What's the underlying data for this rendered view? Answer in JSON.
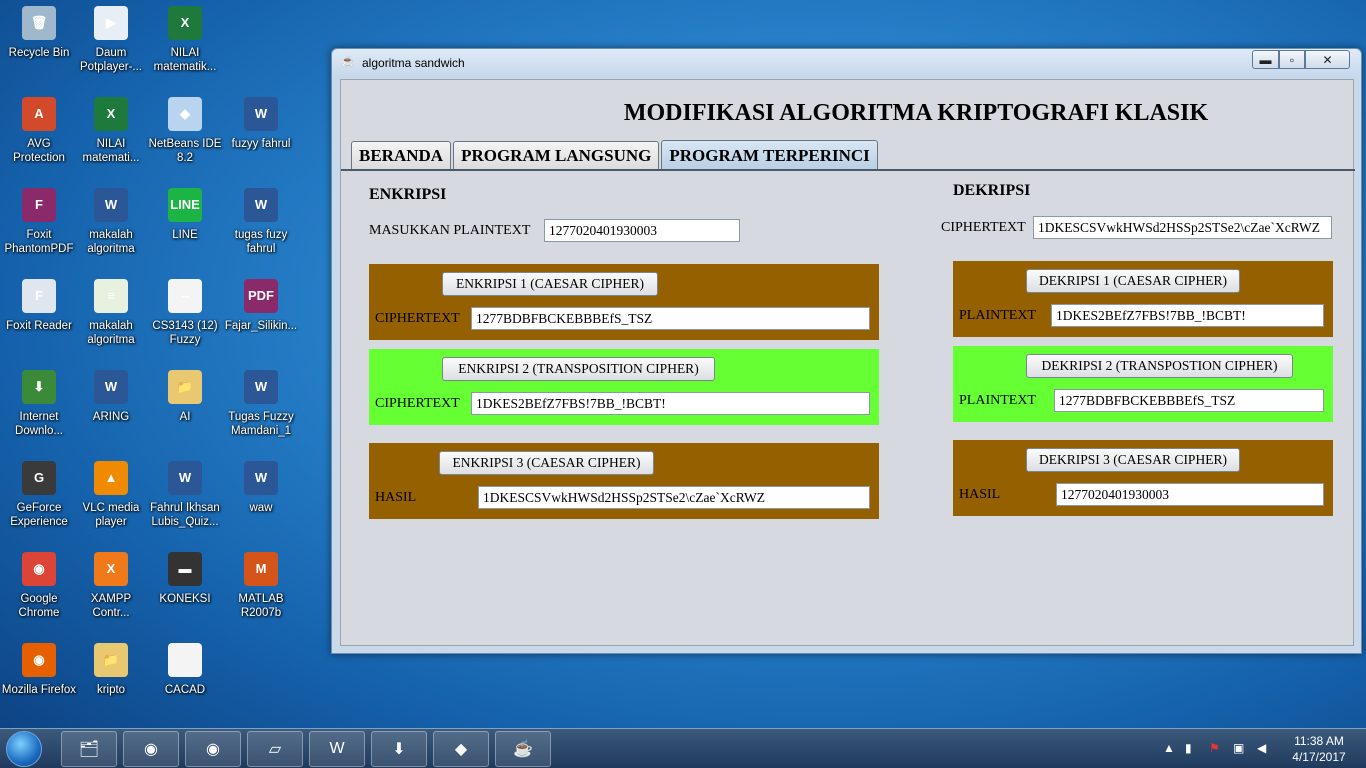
{
  "desktop": {
    "icons": [
      {
        "label": "Recycle Bin",
        "icon": "recycle-bin-icon",
        "color": "#9fb8cc",
        "glyph": "🗑"
      },
      {
        "label": "Daum Potplayer-...",
        "icon": "potplayer-icon",
        "color": "#e8eef5",
        "glyph": "▶"
      },
      {
        "label": "NILAI matematik...",
        "icon": "excel-file-icon",
        "color": "#1e7a3c",
        "glyph": "X"
      },
      {
        "label": "AVG Protection",
        "icon": "avg-icon",
        "color": "#d24a2a",
        "glyph": "A"
      },
      {
        "label": "NILAI matemati...",
        "icon": "excel-file-icon",
        "color": "#1e7a3c",
        "glyph": "X"
      },
      {
        "label": "NetBeans IDE 8.2",
        "icon": "netbeans-icon",
        "color": "#b8d4ee",
        "glyph": "◆"
      },
      {
        "label": "fuzyy fahrul",
        "icon": "word-file-icon",
        "color": "#2b5797",
        "glyph": "W"
      },
      {
        "label": "Foxit PhantomPDF",
        "icon": "foxit-phantom-icon",
        "color": "#8a2a6a",
        "glyph": "F"
      },
      {
        "label": "makalah algoritma",
        "icon": "word-file-icon",
        "color": "#2b5797",
        "glyph": "W"
      },
      {
        "label": "LINE",
        "icon": "line-app-icon",
        "color": "#1db446",
        "glyph": "LINE"
      },
      {
        "label": "tugas fuzy fahrul",
        "icon": "word-file-icon",
        "color": "#2b5797",
        "glyph": "W"
      },
      {
        "label": "Foxit Reader",
        "icon": "foxit-reader-icon",
        "color": "#e0e6ee",
        "glyph": "F"
      },
      {
        "label": "makalah algoritma",
        "icon": "document-icon",
        "color": "#e8f0e0",
        "glyph": "≡"
      },
      {
        "label": "CS3143 (12) Fuzzy",
        "icon": "text-file-icon",
        "color": "#f4f4f4",
        "glyph": "--"
      },
      {
        "label": "Fajar_Silikin...",
        "icon": "pdf-file-icon",
        "color": "#8a2a6a",
        "glyph": "PDF"
      },
      {
        "label": "Internet Downlo...",
        "icon": "idm-icon",
        "color": "#3a8a3a",
        "glyph": "⬇"
      },
      {
        "label": "ARING",
        "icon": "word-file-icon",
        "color": "#2b5797",
        "glyph": "W"
      },
      {
        "label": "AI",
        "icon": "folder-icon",
        "color": "#e8c870",
        "glyph": "📁"
      },
      {
        "label": "Tugas Fuzzy Mamdani_1",
        "icon": "word-file-icon",
        "color": "#2b5797",
        "glyph": "W"
      },
      {
        "label": "GeForce Experience",
        "icon": "geforce-icon",
        "color": "#3a3a3a",
        "glyph": "G"
      },
      {
        "label": "VLC media player",
        "icon": "vlc-icon",
        "color": "#f08a00",
        "glyph": "▲"
      },
      {
        "label": "Fahrul Ikhsan Lubis_Quiz...",
        "icon": "word-file-icon",
        "color": "#2b5797",
        "glyph": "W"
      },
      {
        "label": "waw",
        "icon": "word-file-icon",
        "color": "#2b5797",
        "glyph": "W"
      },
      {
        "label": "Google Chrome",
        "icon": "chrome-icon",
        "color": "#db4437",
        "glyph": "◉"
      },
      {
        "label": "XAMPP Contr...",
        "icon": "xampp-icon",
        "color": "#f07a1a",
        "glyph": "X"
      },
      {
        "label": "KONEKSI",
        "icon": "connection-icon",
        "color": "#333",
        "glyph": "▬"
      },
      {
        "label": "MATLAB R2007b",
        "icon": "matlab-icon",
        "color": "#d4541a",
        "glyph": "M"
      },
      {
        "label": "Mozilla Firefox",
        "icon": "firefox-icon",
        "color": "#e66000",
        "glyph": "◉"
      },
      {
        "label": "kripto",
        "icon": "folder-icon",
        "color": "#e8c870",
        "glyph": "📁"
      },
      {
        "label": "CACAD",
        "icon": "blank-file-icon",
        "color": "#f4f4f4",
        "glyph": ""
      }
    ]
  },
  "window": {
    "title": "algoritma sandwich",
    "min_glyph": "▬",
    "max_glyph": "▫",
    "close_glyph": "✕"
  },
  "app": {
    "heading": "MODIFIKASI ALGORITMA KRIPTOGRAFI  KLASIK",
    "tabs": [
      "BERANDA",
      "PROGRAM LANGSUNG",
      "PROGRAM TERPERINCI"
    ],
    "active_tab": 2,
    "enkripsi": {
      "title": "ENKRIPSI",
      "plaintext_label": "MASUKKAN PLAINTEXT",
      "plaintext_value": "1277020401930003",
      "step1": {
        "button": "ENKRIPSI 1 (CAESAR CIPHER)",
        "label": "CIPHERTEXT",
        "value": "1277BDBFBCKEBBBEfS_TSZ"
      },
      "step2": {
        "button": "ENKRIPSI 2 (TRANSPOSITION CIPHER)",
        "label": "CIPHERTEXT",
        "value": "1DKES2BEfZ7FBS!7BB_!BCBT!"
      },
      "step3": {
        "button": "ENKRIPSI 3 (CAESAR CIPHER)",
        "label": "HASIL",
        "value": "1DKESCSVwkHWSd2HSSp2STSe2\\cZae`XcRWZ"
      }
    },
    "dekripsi": {
      "title": "DEKRIPSI",
      "ciphertext_label": "CIPHERTEXT",
      "ciphertext_value": "1DKESCSVwkHWSd2HSSp2STSe2\\cZae`XcRWZ",
      "step1": {
        "button": "DEKRIPSI 1 (CAESAR CIPHER)",
        "label": "PLAINTEXT",
        "value": "1DKES2BEfZ7FBS!7BB_!BCBT!"
      },
      "step2": {
        "button": "DEKRIPSI 2 (TRANSPOSTION CIPHER)",
        "label": "PLAINTEXT",
        "value": "1277BDBFBCKEBBBEfS_TSZ"
      },
      "step3": {
        "button": "DEKRIPSI 3 (CAESAR CIPHER)",
        "label": "HASIL",
        "value": "1277020401930003"
      }
    },
    "colors": {
      "brown_panel": "#946000",
      "green_panel": "#66ff33"
    }
  },
  "taskbar": {
    "items": [
      {
        "name": "explorer-taskbar-icon",
        "glyph": "🗂"
      },
      {
        "name": "chrome-taskbar-icon",
        "glyph": "◉"
      },
      {
        "name": "firefox-taskbar-icon",
        "glyph": "◉"
      },
      {
        "name": "notes-taskbar-icon",
        "glyph": "▱"
      },
      {
        "name": "word-taskbar-icon",
        "glyph": "W"
      },
      {
        "name": "idm-taskbar-icon",
        "glyph": "⬇"
      },
      {
        "name": "netbeans-taskbar-icon",
        "glyph": "◆"
      },
      {
        "name": "java-taskbar-icon",
        "glyph": "☕"
      }
    ],
    "time": "11:38 AM",
    "date": "4/17/2017"
  }
}
